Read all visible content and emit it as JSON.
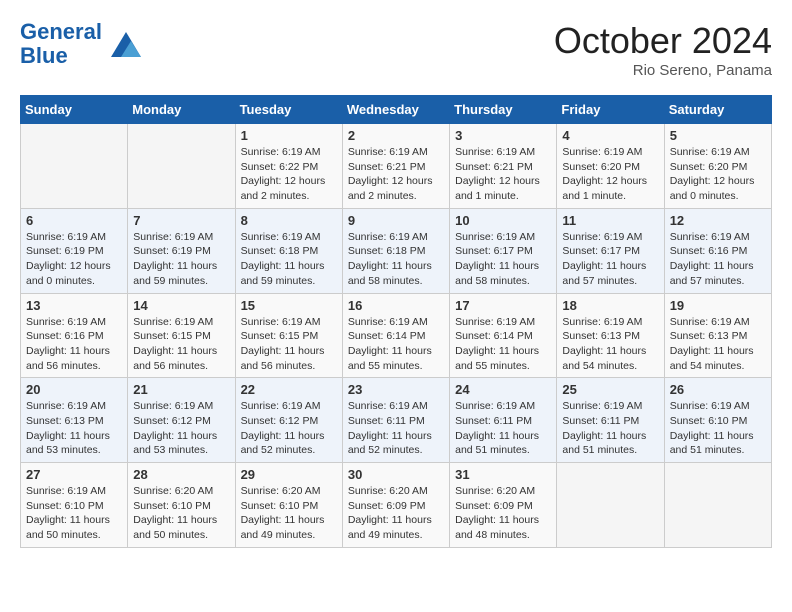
{
  "header": {
    "logo_line1": "General",
    "logo_line2": "Blue",
    "month": "October 2024",
    "location": "Rio Sereno, Panama"
  },
  "weekdays": [
    "Sunday",
    "Monday",
    "Tuesday",
    "Wednesday",
    "Thursday",
    "Friday",
    "Saturday"
  ],
  "weeks": [
    [
      {
        "day": "",
        "info": ""
      },
      {
        "day": "",
        "info": ""
      },
      {
        "day": "1",
        "info": "Sunrise: 6:19 AM\nSunset: 6:22 PM\nDaylight: 12 hours and 2 minutes."
      },
      {
        "day": "2",
        "info": "Sunrise: 6:19 AM\nSunset: 6:21 PM\nDaylight: 12 hours and 2 minutes."
      },
      {
        "day": "3",
        "info": "Sunrise: 6:19 AM\nSunset: 6:21 PM\nDaylight: 12 hours and 1 minute."
      },
      {
        "day": "4",
        "info": "Sunrise: 6:19 AM\nSunset: 6:20 PM\nDaylight: 12 hours and 1 minute."
      },
      {
        "day": "5",
        "info": "Sunrise: 6:19 AM\nSunset: 6:20 PM\nDaylight: 12 hours and 0 minutes."
      }
    ],
    [
      {
        "day": "6",
        "info": "Sunrise: 6:19 AM\nSunset: 6:19 PM\nDaylight: 12 hours and 0 minutes."
      },
      {
        "day": "7",
        "info": "Sunrise: 6:19 AM\nSunset: 6:19 PM\nDaylight: 11 hours and 59 minutes."
      },
      {
        "day": "8",
        "info": "Sunrise: 6:19 AM\nSunset: 6:18 PM\nDaylight: 11 hours and 59 minutes."
      },
      {
        "day": "9",
        "info": "Sunrise: 6:19 AM\nSunset: 6:18 PM\nDaylight: 11 hours and 58 minutes."
      },
      {
        "day": "10",
        "info": "Sunrise: 6:19 AM\nSunset: 6:17 PM\nDaylight: 11 hours and 58 minutes."
      },
      {
        "day": "11",
        "info": "Sunrise: 6:19 AM\nSunset: 6:17 PM\nDaylight: 11 hours and 57 minutes."
      },
      {
        "day": "12",
        "info": "Sunrise: 6:19 AM\nSunset: 6:16 PM\nDaylight: 11 hours and 57 minutes."
      }
    ],
    [
      {
        "day": "13",
        "info": "Sunrise: 6:19 AM\nSunset: 6:16 PM\nDaylight: 11 hours and 56 minutes."
      },
      {
        "day": "14",
        "info": "Sunrise: 6:19 AM\nSunset: 6:15 PM\nDaylight: 11 hours and 56 minutes."
      },
      {
        "day": "15",
        "info": "Sunrise: 6:19 AM\nSunset: 6:15 PM\nDaylight: 11 hours and 56 minutes."
      },
      {
        "day": "16",
        "info": "Sunrise: 6:19 AM\nSunset: 6:14 PM\nDaylight: 11 hours and 55 minutes."
      },
      {
        "day": "17",
        "info": "Sunrise: 6:19 AM\nSunset: 6:14 PM\nDaylight: 11 hours and 55 minutes."
      },
      {
        "day": "18",
        "info": "Sunrise: 6:19 AM\nSunset: 6:13 PM\nDaylight: 11 hours and 54 minutes."
      },
      {
        "day": "19",
        "info": "Sunrise: 6:19 AM\nSunset: 6:13 PM\nDaylight: 11 hours and 54 minutes."
      }
    ],
    [
      {
        "day": "20",
        "info": "Sunrise: 6:19 AM\nSunset: 6:13 PM\nDaylight: 11 hours and 53 minutes."
      },
      {
        "day": "21",
        "info": "Sunrise: 6:19 AM\nSunset: 6:12 PM\nDaylight: 11 hours and 53 minutes."
      },
      {
        "day": "22",
        "info": "Sunrise: 6:19 AM\nSunset: 6:12 PM\nDaylight: 11 hours and 52 minutes."
      },
      {
        "day": "23",
        "info": "Sunrise: 6:19 AM\nSunset: 6:11 PM\nDaylight: 11 hours and 52 minutes."
      },
      {
        "day": "24",
        "info": "Sunrise: 6:19 AM\nSunset: 6:11 PM\nDaylight: 11 hours and 51 minutes."
      },
      {
        "day": "25",
        "info": "Sunrise: 6:19 AM\nSunset: 6:11 PM\nDaylight: 11 hours and 51 minutes."
      },
      {
        "day": "26",
        "info": "Sunrise: 6:19 AM\nSunset: 6:10 PM\nDaylight: 11 hours and 51 minutes."
      }
    ],
    [
      {
        "day": "27",
        "info": "Sunrise: 6:19 AM\nSunset: 6:10 PM\nDaylight: 11 hours and 50 minutes."
      },
      {
        "day": "28",
        "info": "Sunrise: 6:20 AM\nSunset: 6:10 PM\nDaylight: 11 hours and 50 minutes."
      },
      {
        "day": "29",
        "info": "Sunrise: 6:20 AM\nSunset: 6:10 PM\nDaylight: 11 hours and 49 minutes."
      },
      {
        "day": "30",
        "info": "Sunrise: 6:20 AM\nSunset: 6:09 PM\nDaylight: 11 hours and 49 minutes."
      },
      {
        "day": "31",
        "info": "Sunrise: 6:20 AM\nSunset: 6:09 PM\nDaylight: 11 hours and 48 minutes."
      },
      {
        "day": "",
        "info": ""
      },
      {
        "day": "",
        "info": ""
      }
    ]
  ]
}
